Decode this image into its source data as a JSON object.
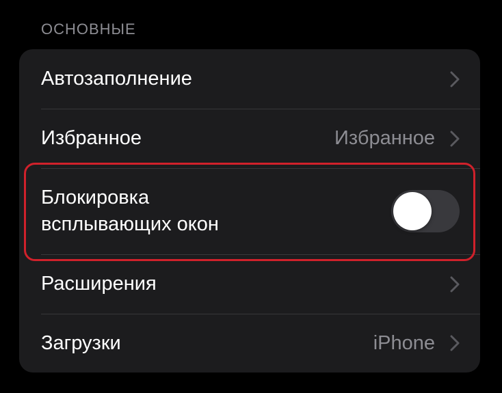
{
  "section": {
    "header": "ОСНОВНЫЕ"
  },
  "rows": {
    "autofill": {
      "label": "Автозаполнение"
    },
    "favorites": {
      "label": "Избранное",
      "value": "Избранное"
    },
    "popups": {
      "label_line1": "Блокировка",
      "label_line2": "всплывающих окон",
      "toggle_on": false
    },
    "extensions": {
      "label": "Расширения"
    },
    "downloads": {
      "label": "Загрузки",
      "value": "iPhone"
    }
  },
  "icons": {
    "chevron": "chevron-right-icon"
  },
  "colors": {
    "background": "#000000",
    "group_background": "#1c1c1e",
    "text_primary": "#ffffff",
    "text_secondary": "#8d8d93",
    "toggle_off": "#39393d",
    "highlight_border": "#d0212b"
  }
}
